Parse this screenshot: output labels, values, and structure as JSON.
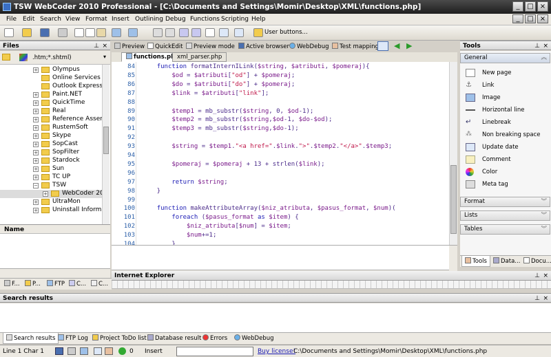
{
  "window": {
    "title": "TSW WebCoder 2010 Professional - [C:\\Documents and Settings\\Momir\\Desktop\\XML\\functions.php]"
  },
  "menu": [
    "File",
    "Edit",
    "Search",
    "View",
    "Format",
    "Insert",
    "Outlining",
    "Debug",
    "Functions",
    "Scripting",
    "Help"
  ],
  "toolbar": {
    "user_buttons": "User buttons..."
  },
  "preview_toolbar": {
    "preview": "Preview",
    "quickedit": "QuickEdit",
    "preview_mode": "Preview mode",
    "active_browser": "Active browser",
    "webdebug": "WebDebug",
    "test_mappings": "Test mappings"
  },
  "files_panel": {
    "title": "Files",
    "filter": ".htm;*.shtml)",
    "tree": [
      "Olympus",
      "Online Services",
      "Outlook Express",
      "Paint.NET",
      "QuickTime",
      "Real",
      "Reference Asser",
      "RustemSoft",
      "Skype",
      "SopCast",
      "SopFilter",
      "Stardock",
      "Sun",
      "TC UP",
      "TSW",
      "WebCoder 20",
      "UltraMon",
      "Uninstall Inform"
    ],
    "name_header": "Name",
    "bottom_tabs": [
      "F...",
      "P...",
      "FTP",
      "C...",
      "C..."
    ]
  },
  "editor": {
    "tabs": [
      "functions.php",
      "xml_parser.php"
    ],
    "lines": [
      {
        "n": "84",
        "t": "    function formatInternILink($string, $atributi, $pomeraj){"
      },
      {
        "n": "85",
        "t": "        $od = $atributi[\"od\"] + $pomeraj;"
      },
      {
        "n": "86",
        "t": "        $do = $atributi[\"do\"] + $pomeraj;"
      },
      {
        "n": "87",
        "t": "        $link = $atributi[\"link\"];"
      },
      {
        "n": "88",
        "t": ""
      },
      {
        "n": "89",
        "t": "        $temp1 = mb_substr($string, 0, $od-1);"
      },
      {
        "n": "90",
        "t": "        $temp2 = mb_substr($string,$od-1, $do-$od);"
      },
      {
        "n": "91",
        "t": "        $temp3 = mb_substr($string,$do-1);"
      },
      {
        "n": "92",
        "t": ""
      },
      {
        "n": "93",
        "t": "        $string = $temp1.\"<a href=\".$link.\">\".$temp2.\"</a>\".$temp3;"
      },
      {
        "n": "94",
        "t": ""
      },
      {
        "n": "95",
        "t": "        $pomeraj = $pomeraj + 13 + strlen($link);"
      },
      {
        "n": "96",
        "t": ""
      },
      {
        "n": "97",
        "t": "        return $string;"
      },
      {
        "n": "98",
        "t": "    }"
      },
      {
        "n": "99",
        "t": ""
      },
      {
        "n": "100",
        "t": "    function makeAttributeArray($niz_atributa, $pasus_format, $num)("
      },
      {
        "n": "101",
        "t": "        foreach ($pasus_format as $item) {"
      },
      {
        "n": "102",
        "t": "            $niz_atributa[$num] = $item;"
      },
      {
        "n": "103",
        "t": "            $num+=1;"
      },
      {
        "n": "104",
        "t": "        }"
      }
    ]
  },
  "tools_panel": {
    "title": "Tools",
    "general": "General",
    "items": [
      "New page",
      "Link",
      "Image",
      "Horizontal line",
      "Linebreak",
      "Non breaking space",
      "Update date",
      "Comment",
      "Color",
      "Meta tag"
    ],
    "sections": [
      "Format",
      "Lists",
      "Tables"
    ],
    "bottom_tabs": [
      "Tools",
      "Data...",
      "Docu..."
    ]
  },
  "ie_panel": {
    "title": "Internet Explorer"
  },
  "search_panel": {
    "title": "Search results"
  },
  "bottom_tabs": [
    "Search results",
    "FTP Log",
    "Project ToDo list",
    "Database result",
    "Errors",
    "WebDebug"
  ],
  "status": {
    "position": "Line 1 Char 1",
    "count": "0",
    "mode": "Insert",
    "buy": "Buy license!",
    "path": "C:\\Documents and Settings\\Momir\\Desktop\\XML\\functions.php"
  }
}
